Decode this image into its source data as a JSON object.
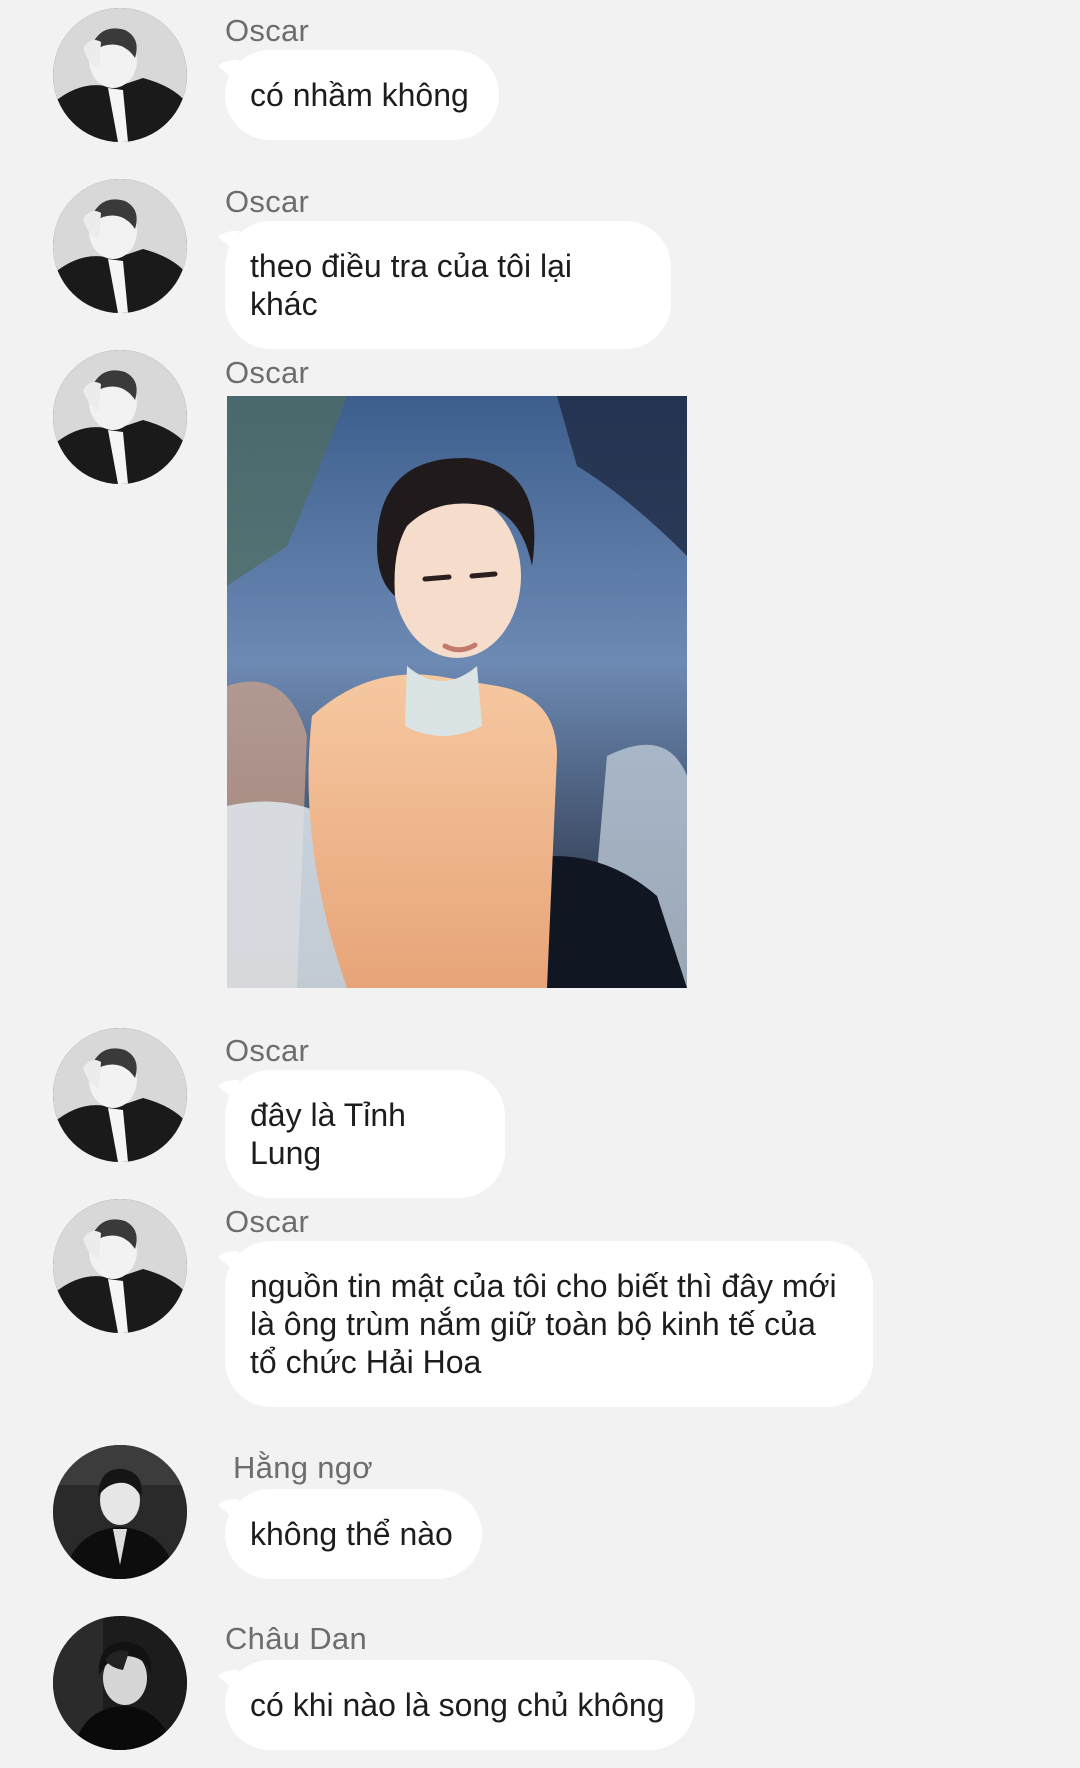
{
  "messages": [
    {
      "sender": "Oscar",
      "type": "text",
      "text": "có nhầm không",
      "avatar": "oscar-avatar"
    },
    {
      "sender": "Oscar",
      "type": "text",
      "text": "theo điều tra của tôi lại khác",
      "avatar": "oscar-avatar"
    },
    {
      "sender": "Oscar",
      "type": "image",
      "avatar": "oscar-avatar",
      "image": "portrait-photo"
    },
    {
      "sender": "Oscar",
      "type": "text",
      "text": "đây là Tỉnh Lung",
      "avatar": "oscar-avatar"
    },
    {
      "sender": "Oscar",
      "type": "text",
      "text": "nguồn tin mật của tôi cho biết thì đây mới là ông trùm nắm giữ toàn bộ kinh tế của tổ chức Hải Hoa",
      "avatar": "oscar-avatar"
    },
    {
      "sender": "Hằng ngơ",
      "type": "text",
      "text": "không thể nào",
      "avatar": "hang-ngo-avatar"
    },
    {
      "sender": "Châu Dan",
      "type": "text",
      "text": "có khi nào là song chủ không",
      "avatar": "chau-dan-avatar"
    }
  ],
  "colors": {
    "background": "#f2f2f2",
    "bubble": "#ffffff",
    "sender_name": "#6d6d6d",
    "text": "#1d1d1d"
  }
}
